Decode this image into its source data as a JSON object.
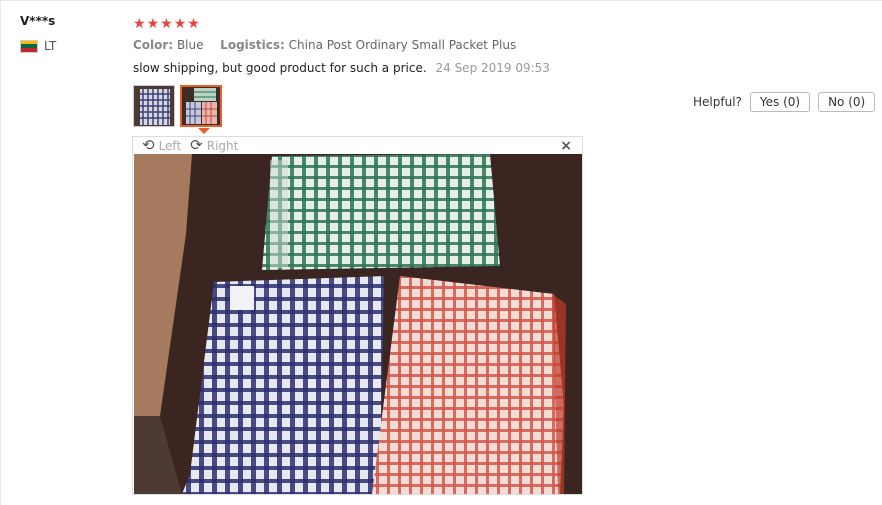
{
  "review": {
    "user_name": "V***s",
    "country_code": "LT",
    "flag_colors": [
      "#fdb913",
      "#006a44",
      "#c1272d"
    ],
    "rating_stars": 5,
    "color_label": "Color:",
    "color_value": "Blue",
    "logistics_label": "Logistics:",
    "logistics_value": "China Post Ordinary Small Packet Plus",
    "feedback": "slow shipping, but good product for such a price.",
    "date": "24 Sep 2019 09:53",
    "helpful_label": "Helpful?",
    "yes_label": "Yes (0)",
    "no_label": "No (0)",
    "accent_color": "#e8602c",
    "star_color": "#e8453c"
  },
  "viewer": {
    "rotate_left_label": "Left",
    "rotate_right_label": "Right",
    "close_symbol": "×"
  }
}
